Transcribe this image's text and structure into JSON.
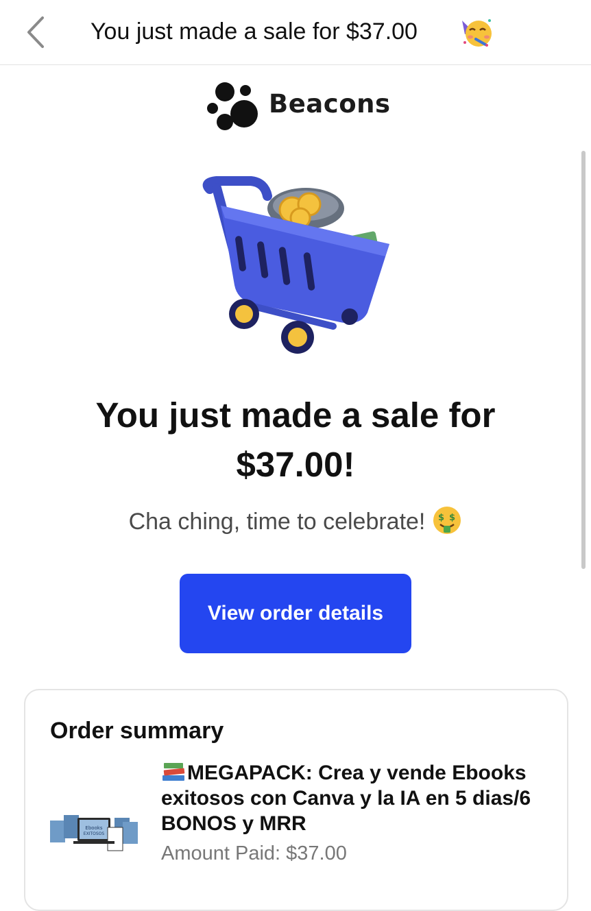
{
  "header": {
    "back_icon": "chevron-left-icon",
    "title": "You just made a sale for $37.00",
    "title_emoji": "partying-face-icon"
  },
  "brand": {
    "name": "Beacons",
    "logo_icon": "beacons-dots-logo"
  },
  "hero": {
    "illustration": "shopping-cart-with-money-icon",
    "headline": "You just made a sale for $37.00!",
    "subtitle": "Cha ching, time to celebrate!",
    "subtitle_emoji": "money-mouth-face-icon"
  },
  "cta": {
    "label": "View order details",
    "color": "#2446f0"
  },
  "order_summary": {
    "title": "Order summary",
    "product": {
      "emoji": "books-icon",
      "name": "MEGAPACK: Crea y vende Ebooks exitosos con Canva y la IA en 5 dias/6 BONOS y MRR",
      "thumbnail_label": "Ebooks EXITOSOS",
      "amount_paid": "Amount Paid: $37.00"
    }
  }
}
